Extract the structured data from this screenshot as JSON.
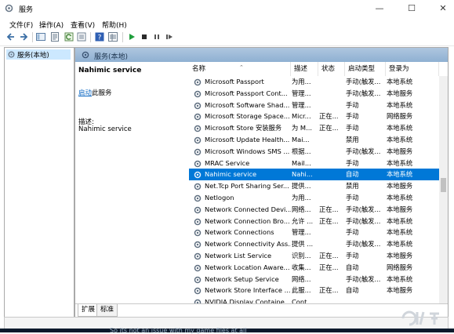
{
  "window": {
    "title": "服务"
  },
  "menu": [
    "文件(F)",
    "操作(A)",
    "查看(V)",
    "帮助(H)"
  ],
  "toolbar_icons": [
    "back-arrow-icon",
    "forward-arrow-icon",
    "console-tree-icon",
    "properties-view-icon",
    "refresh-icon",
    "export-list-icon",
    "help-icon",
    "details-view-icon",
    "play-icon",
    "stop-icon",
    "pause-icon",
    "restart-icon"
  ],
  "tree": {
    "selected": "服务(本地)"
  },
  "pane_header": {
    "title": "服务(本地)"
  },
  "details": {
    "service_name": "Nahimic service",
    "start_link": "启动",
    "start_suffix": "此服务",
    "desc_label": "描述:",
    "desc_value": "Nahimic service"
  },
  "columns": [
    "名称",
    "描述",
    "状态",
    "启动类型",
    "登录为"
  ],
  "rows": [
    {
      "name": "Microsoft Passport",
      "desc": "为用...",
      "status": "",
      "startup": "手动(触发...",
      "logon": "本地系统"
    },
    {
      "name": "Microsoft Passport Cont...",
      "desc": "管理...",
      "status": "",
      "startup": "手动(触发...",
      "logon": "本地服务"
    },
    {
      "name": "Microsoft Software Shad...",
      "desc": "管理...",
      "status": "",
      "startup": "手动",
      "logon": "本地系统"
    },
    {
      "name": "Microsoft Storage Space...",
      "desc": "Micr...",
      "status": "正在...",
      "startup": "手动",
      "logon": "网络服务"
    },
    {
      "name": "Microsoft Store 安装服务",
      "desc": "为 M...",
      "status": "正在...",
      "startup": "手动",
      "logon": "本地系统"
    },
    {
      "name": "Microsoft Update Health...",
      "desc": "Mai...",
      "status": "",
      "startup": "禁用",
      "logon": "本地系统"
    },
    {
      "name": "Microsoft Windows SMS ...",
      "desc": "根据...",
      "status": "",
      "startup": "手动(触发...",
      "logon": "本地服务"
    },
    {
      "name": "MRAC Service",
      "desc": "Mail...",
      "status": "",
      "startup": "手动",
      "logon": "本地系统"
    },
    {
      "name": "Nahimic service",
      "desc": "Nahi...",
      "status": "",
      "startup": "自动",
      "logon": "本地系统",
      "selected": true
    },
    {
      "name": "Net.Tcp Port Sharing Ser...",
      "desc": "提供...",
      "status": "",
      "startup": "禁用",
      "logon": "本地服务"
    },
    {
      "name": "Netlogon",
      "desc": "为用...",
      "status": "",
      "startup": "手动",
      "logon": "本地系统"
    },
    {
      "name": "Network Connected Devi...",
      "desc": "网络...",
      "status": "正在...",
      "startup": "手动(触发...",
      "logon": "本地服务"
    },
    {
      "name": "Network Connection Bro...",
      "desc": "允许 ...",
      "status": "正在...",
      "startup": "手动(触发...",
      "logon": "本地系统"
    },
    {
      "name": "Network Connections",
      "desc": "管理...",
      "status": "",
      "startup": "手动",
      "logon": "本地系统"
    },
    {
      "name": "Network Connectivity Ass...",
      "desc": "提供 ...",
      "status": "",
      "startup": "手动(触发...",
      "logon": "本地系统"
    },
    {
      "name": "Network List Service",
      "desc": "识别...",
      "status": "正在...",
      "startup": "手动",
      "logon": "本地服务"
    },
    {
      "name": "Network Location Aware...",
      "desc": "收集...",
      "status": "正在...",
      "startup": "自动",
      "logon": "网络服务"
    },
    {
      "name": "Network Setup Service",
      "desc": "网络...",
      "status": "",
      "startup": "手动(触发...",
      "logon": "本地系统"
    },
    {
      "name": "Network Store Interface ...",
      "desc": "此服...",
      "status": "正在...",
      "startup": "自动",
      "logon": "本地服务"
    },
    {
      "name": "NVIDIA Display Containe...",
      "desc": "Cont...",
      "status": "",
      "startup": "",
      "logon": ""
    }
  ],
  "tabs": [
    "扩展",
    "标准"
  ],
  "bottom_text": "So its not an issue with my game files at all",
  "colors": {
    "selection": "#0078d7",
    "header": "#9bbad8",
    "tree_select": "#cce8ff"
  }
}
